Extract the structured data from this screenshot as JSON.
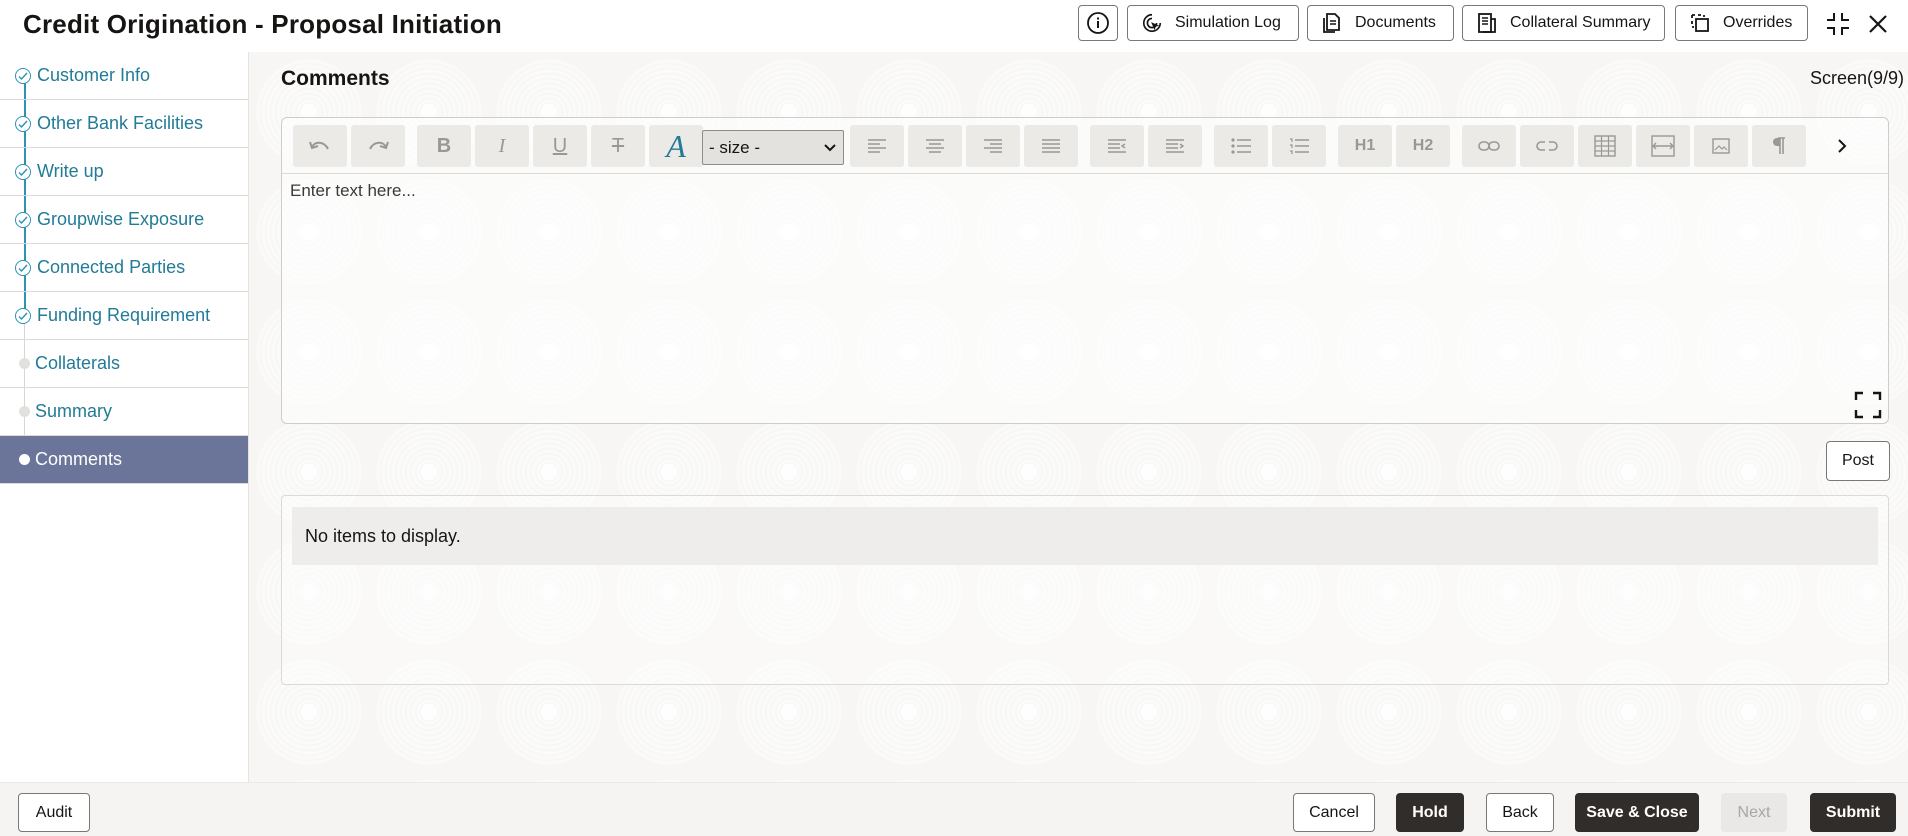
{
  "header": {
    "title": "Credit Origination - Proposal Initiation",
    "buttons": {
      "simulation_log": "Simulation Log",
      "documents": "Documents",
      "collateral_summary": "Collateral Summary",
      "overrides": "Overrides"
    },
    "icons": [
      "info-icon",
      "simulation-log-icon",
      "documents-icon",
      "collateral-summary-icon",
      "overrides-icon",
      "minimize-icon",
      "close-icon"
    ]
  },
  "sidebar": {
    "items": [
      {
        "label": "Customer Info",
        "state": "completed"
      },
      {
        "label": "Other Bank Facilities",
        "state": "completed"
      },
      {
        "label": "Write up",
        "state": "completed"
      },
      {
        "label": "Groupwise Exposure",
        "state": "completed"
      },
      {
        "label": "Connected Parties",
        "state": "completed"
      },
      {
        "label": "Funding Requirement",
        "state": "completed"
      },
      {
        "label": "Collaterals",
        "state": "pending"
      },
      {
        "label": "Summary",
        "state": "pending"
      },
      {
        "label": "Comments",
        "state": "active"
      }
    ]
  },
  "main": {
    "section_title": "Comments",
    "screen_count": "Screen(9/9)",
    "editor": {
      "placeholder": "Enter text here...",
      "size_select": "- size -",
      "heading1": "H1",
      "heading2": "H2"
    },
    "post_label": "Post",
    "empty_message": "No items to display."
  },
  "footer": {
    "audit": "Audit",
    "cancel": "Cancel",
    "hold": "Hold",
    "back": "Back",
    "save_close": "Save & Close",
    "next": "Next",
    "submit": "Submit"
  },
  "colors": {
    "accent": "#227b97",
    "active_nav": "#6b7599",
    "dark_button": "#312d2a"
  }
}
